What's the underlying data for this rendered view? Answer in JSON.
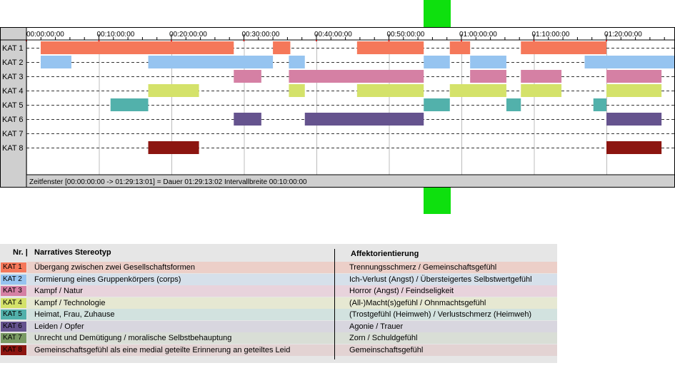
{
  "chart_data": {
    "type": "timeline",
    "time_ticks": [
      "00:00:00:00",
      "00:10:00:00",
      "00:20:00:00",
      "00:30:00:00",
      "00:40:00:00",
      "00:50:00:00",
      "01:00:00:00",
      "01:10:00:00",
      "01:20:00:00"
    ],
    "xlim_minutes": [
      0,
      89.22
    ],
    "rows": [
      {
        "label": "KAT 1",
        "color": "#f5785a",
        "intervals": [
          [
            -2,
            28.6
          ],
          [
            34,
            36.4
          ],
          [
            45.6,
            54.8
          ],
          [
            58.4,
            61.2
          ],
          [
            68.2,
            80
          ]
        ]
      },
      {
        "label": "KAT 2",
        "color": "#96c4f0",
        "intervals": [
          [
            -2,
            6.2
          ],
          [
            16.8,
            34
          ],
          [
            36.2,
            38.4
          ],
          [
            54.8,
            58.4
          ],
          [
            61.2,
            66.2
          ],
          [
            77,
            90
          ]
        ]
      },
      {
        "label": "KAT 3",
        "color": "#d580a4",
        "intervals": [
          [
            28.6,
            32.4
          ],
          [
            36.2,
            54.8
          ],
          [
            61.2,
            66.2
          ],
          [
            68.2,
            73.8
          ],
          [
            80,
            87.6
          ]
        ]
      },
      {
        "label": "KAT 4",
        "color": "#d4e26a",
        "intervals": [
          [
            16.8,
            23.8
          ],
          [
            36.2,
            38.4
          ],
          [
            45.6,
            54.8
          ],
          [
            58.4,
            66.2
          ],
          [
            68.2,
            73.8
          ],
          [
            80,
            87.6
          ]
        ]
      },
      {
        "label": "KAT 5",
        "color": "#52b1ab",
        "intervals": [
          [
            11.6,
            16.8
          ],
          [
            54.8,
            58.4
          ],
          [
            66.2,
            68.2
          ],
          [
            78.2,
            80
          ]
        ]
      },
      {
        "label": "KAT 6",
        "color": "#65538e",
        "intervals": [
          [
            28.6,
            32.4
          ],
          [
            38.4,
            54.8
          ],
          [
            80,
            87.6
          ]
        ]
      },
      {
        "label": "KAT 7",
        "color": "#7a9a64",
        "intervals": []
      },
      {
        "label": "KAT 8",
        "color": "#8c1510",
        "intervals": [
          [
            16.8,
            23.8
          ],
          [
            80,
            87.6
          ]
        ]
      }
    ],
    "status": "Zeitfenster [00:00:00:00 -> 01:29:13:01] = Dauer 01:29:13:02    Intervallbreite 00:10:00:00"
  },
  "legend": {
    "header": {
      "nr": "Nr. |",
      "stereotyp": "Narratives Stereotyp",
      "affekt": "Affektorientierung"
    },
    "rows": [
      {
        "kat": "KAT 1",
        "color": "#f5785a",
        "bg": "#eccfc8",
        "stereotyp": "Übergang zwischen zwei Gesellschaftsformen",
        "affekt": "Trennungsschmerz / Gemeinschaftsgefühl"
      },
      {
        "kat": "KAT 2",
        "color": "#96c4f0",
        "bg": "#d6e0ea",
        "stereotyp": "Formierung eines Gruppenkörpers (corps)",
        "affekt": "Ich-Verlust (Angst) / Übersteigertes Selbstwertgefühl"
      },
      {
        "kat": "KAT 3",
        "color": "#d580a4",
        "bg": "#e8d3dc",
        "stereotyp": "Kampf / Natur",
        "affekt": "Horror (Angst) / Feindseligkeit"
      },
      {
        "kat": "KAT 4",
        "color": "#d4e26a",
        "bg": "#e6e8d2",
        "stereotyp": "Kampf / Technologie",
        "affekt": "(All-)Macht(s)gefühl / Ohnmachtsgefühl"
      },
      {
        "kat": "KAT 5",
        "color": "#52b1ab",
        "bg": "#d2e2df",
        "stereotyp": "Heimat, Frau, Zuhause",
        "affekt": "(Trostgefühl (Heimweh) / Verlustschmerz (Heimweh)"
      },
      {
        "kat": "KAT 6",
        "color": "#65538e",
        "bg": "#d8d6df",
        "stereotyp": "Leiden / Opfer",
        "affekt": "Agonie / Trauer"
      },
      {
        "kat": "KAT 7",
        "color": "#7a9a64",
        "bg": "#d9ded6",
        "stereotyp": "Unrecht und Demütigung / moralische Selbstbehauptung",
        "affekt": "Zorn / Schuldgefühl"
      },
      {
        "kat": "KAT 8",
        "color": "#8c1510",
        "bg": "#e3d3d3",
        "stereotyp": "Gemeinschaftsgefühl als eine medial geteilte Erinnerung an geteiltes Leid",
        "affekt": "Gemeinschaftsgefühl"
      }
    ]
  }
}
